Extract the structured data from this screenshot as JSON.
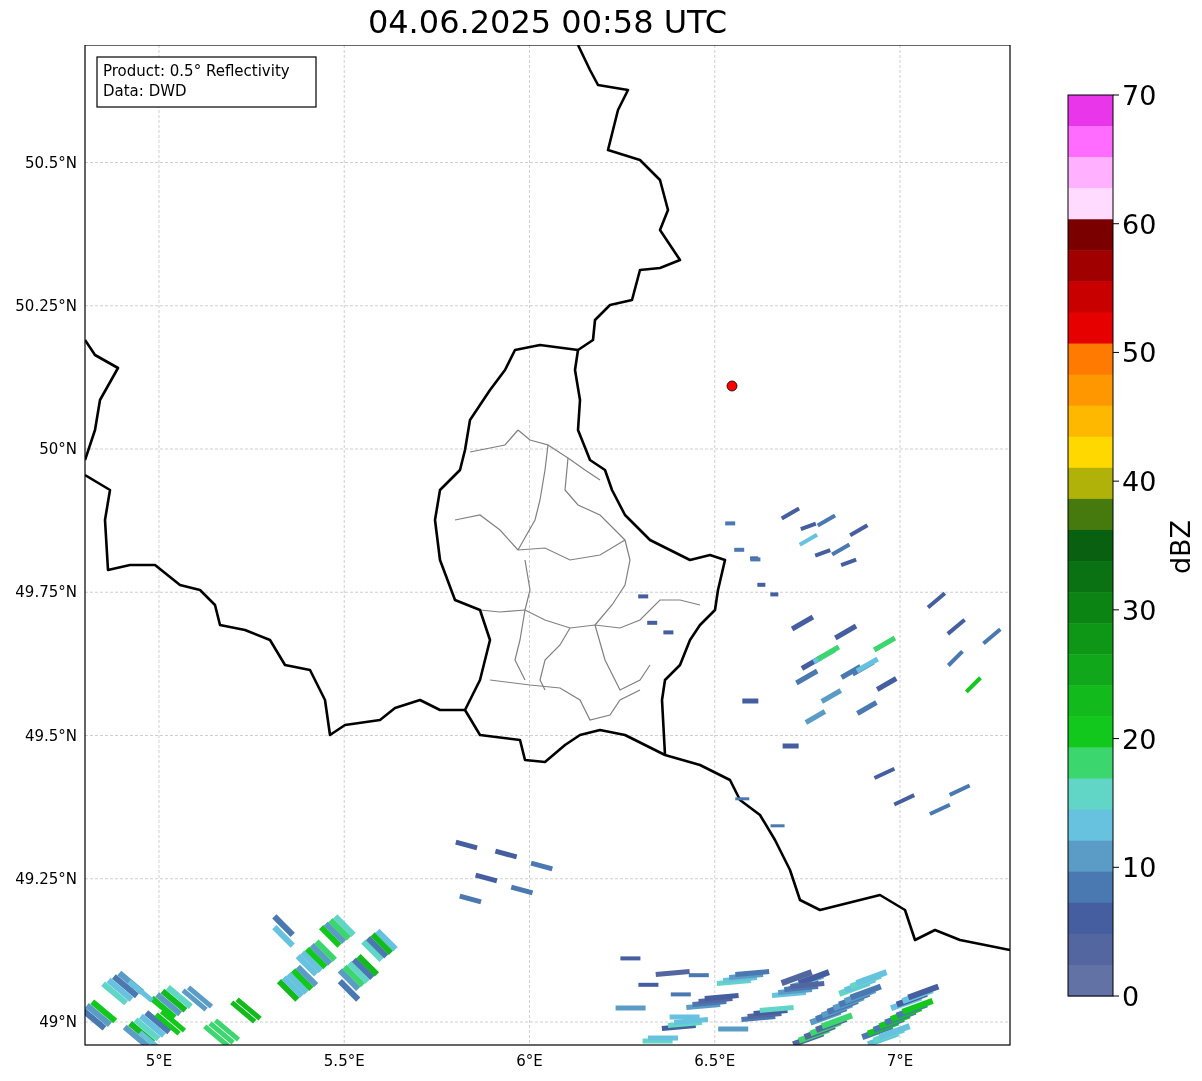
{
  "title": "04.06.2025 00:58 UTC",
  "info_box": [
    "Product: 0.5° Reflectivity",
    "Data: DWD"
  ],
  "map": {
    "xticks": [
      "5°E",
      "5.5°E",
      "6°E",
      "6.5°E",
      "7°E"
    ],
    "yticks": [
      "50.5°N",
      "50.25°N",
      "50°N",
      "49.75°N",
      "49.5°N",
      "49.25°N",
      "49°N"
    ]
  },
  "colorbar": {
    "label": "dBZ",
    "ticks": [
      "70",
      "60",
      "50",
      "40",
      "30",
      "20",
      "10",
      "0"
    ],
    "bins": [
      {
        "color": "#ea36ea"
      },
      {
        "color": "#ff6cff"
      },
      {
        "color": "#ffb0ff"
      },
      {
        "color": "#ffdcff"
      },
      {
        "color": "#7a0000"
      },
      {
        "color": "#a00000"
      },
      {
        "color": "#c80000"
      },
      {
        "color": "#e60000"
      },
      {
        "color": "#ff7a00"
      },
      {
        "color": "#ff9800"
      },
      {
        "color": "#ffb800"
      },
      {
        "color": "#ffd800"
      },
      {
        "color": "#b0b20a"
      },
      {
        "color": "#467a0e"
      },
      {
        "color": "#086010"
      },
      {
        "color": "#0a7212"
      },
      {
        "color": "#0c8414"
      },
      {
        "color": "#0e9616"
      },
      {
        "color": "#10a81a"
      },
      {
        "color": "#12ba1c"
      },
      {
        "color": "#12c81c"
      },
      {
        "color": "#3cd66e"
      },
      {
        "color": "#62d6c6"
      },
      {
        "color": "#66c2de"
      },
      {
        "color": "#5a9cc6"
      },
      {
        "color": "#4a78b0"
      },
      {
        "color": "#455ea0"
      },
      {
        "color": "#5366a0"
      },
      {
        "color": "#6272a4"
      }
    ]
  }
}
